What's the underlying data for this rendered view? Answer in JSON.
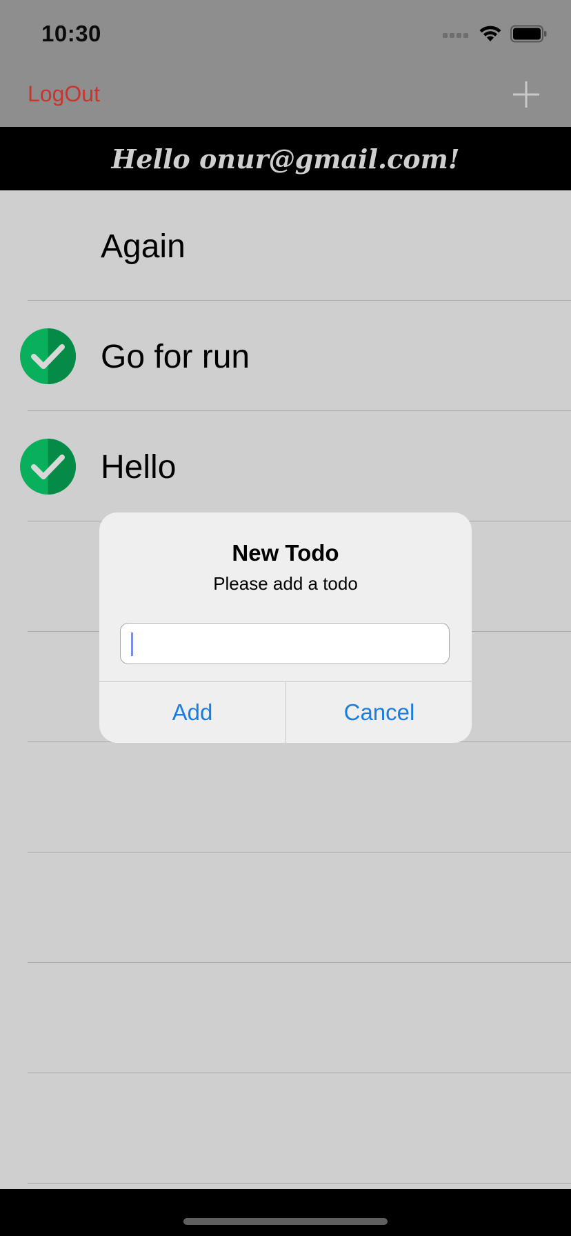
{
  "status_bar": {
    "time": "10:30"
  },
  "nav": {
    "logout_label": "LogOut"
  },
  "banner": {
    "greeting": "Hello onur@gmail.com!"
  },
  "todos": [
    {
      "title": "Again",
      "done": false
    },
    {
      "title": "Go for run",
      "done": true
    },
    {
      "title": "Hello",
      "done": true
    }
  ],
  "alert": {
    "title": "New Todo",
    "message": "Please add a todo",
    "input_value": "",
    "add_label": "Add",
    "cancel_label": "Cancel"
  },
  "colors": {
    "logout": "#c9352d",
    "accent": "#1a7ee0",
    "check_green": "#08a85a",
    "check_green_dark": "#078a4a"
  }
}
